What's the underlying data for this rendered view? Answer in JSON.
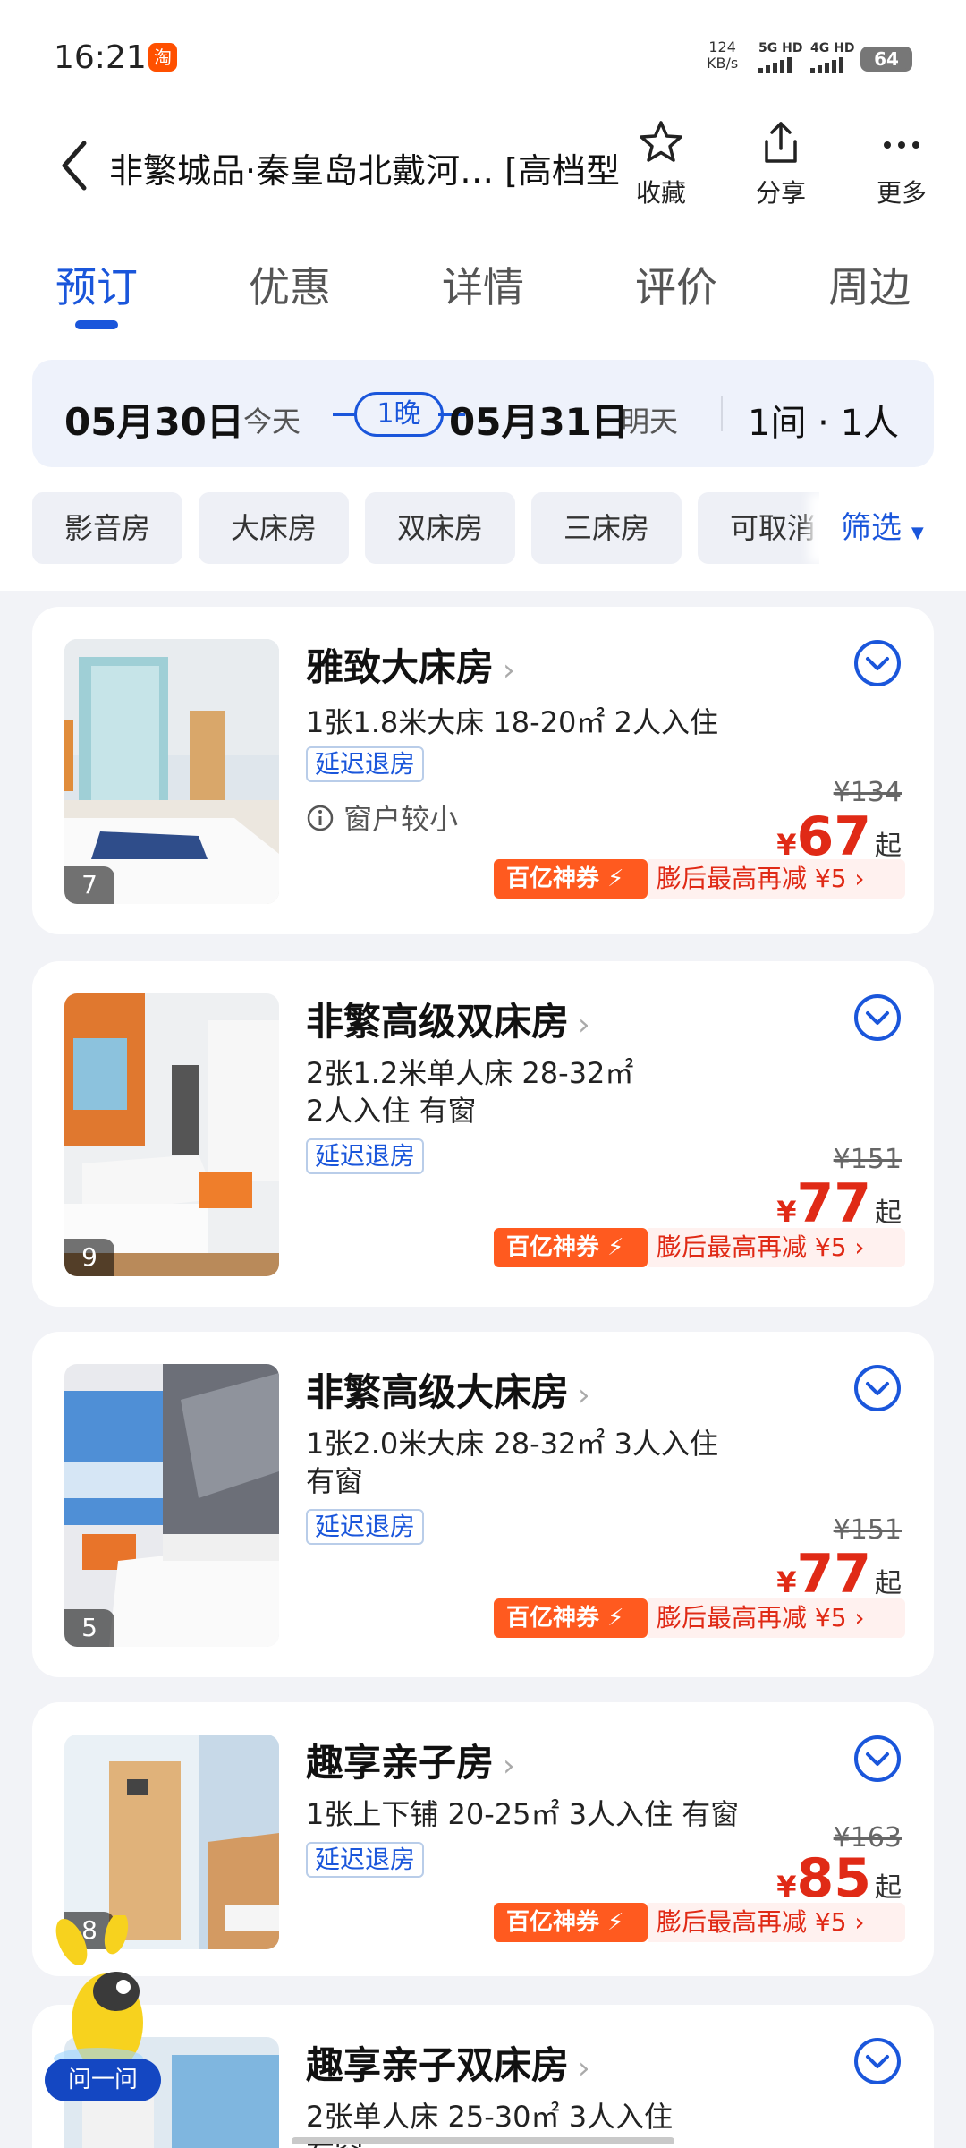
{
  "status_bar": {
    "time": "16:21",
    "app_icon": "淘",
    "net_speed_value": "124",
    "net_speed_unit": "KB/s",
    "sim1": "5G HD",
    "sim2": "4G HD",
    "battery": "64"
  },
  "header": {
    "title": "非繁城品·秦皇岛北戴河… [高档型",
    "favorite_label": "收藏",
    "share_label": "分享",
    "more_label": "更多"
  },
  "tabs": [
    {
      "label": "预订",
      "active": true
    },
    {
      "label": "优惠",
      "active": false
    },
    {
      "label": "详情",
      "active": false
    },
    {
      "label": "评价",
      "active": false
    },
    {
      "label": "周边",
      "active": false
    }
  ],
  "dates": {
    "checkin": "05月30日",
    "checkin_sub": "今天",
    "nights": "1晚",
    "checkout": "05月31日",
    "checkout_sub": "明天",
    "guests": "1间 · 1人"
  },
  "filters": {
    "chips": [
      "影音房",
      "大床房",
      "双床房",
      "三床房",
      "可取消"
    ],
    "filter_label": "筛选"
  },
  "rooms": [
    {
      "name": "雅致大床房",
      "spec_line1": "1张1.8米大床   18-20㎡  2人入住",
      "spec_line2": "",
      "tag": "延迟退房",
      "note": "窗户较小",
      "image_count": "7",
      "old_price": "¥134",
      "currency": "¥",
      "price": "67",
      "price_suffix": "起",
      "promo_badge": "百亿神券",
      "promo_text": "膨后最高再减 ¥5 ›"
    },
    {
      "name": "非繁高级双床房",
      "spec_line1": "2张1.2米单人床   28-32㎡",
      "spec_line2": "2人入住  有窗",
      "tag": "延迟退房",
      "image_count": "9",
      "old_price": "¥151",
      "currency": "¥",
      "price": "77",
      "price_suffix": "起",
      "promo_badge": "百亿神券",
      "promo_text": "膨后最高再减 ¥5 ›"
    },
    {
      "name": "非繁高级大床房",
      "spec_line1": "1张2.0米大床   28-32㎡  3人入住",
      "spec_line2": "有窗",
      "tag": "延迟退房",
      "image_count": "5",
      "old_price": "¥151",
      "currency": "¥",
      "price": "77",
      "price_suffix": "起",
      "promo_badge": "百亿神券",
      "promo_text": "膨后最高再减 ¥5 ›"
    },
    {
      "name": "趣享亲子房",
      "spec_line1": "1张上下铺  20-25㎡  3人入住  有窗",
      "spec_line2": "",
      "tag": "延迟退房",
      "image_count": "8",
      "old_price": "¥163",
      "currency": "¥",
      "price": "85",
      "price_suffix": "起",
      "promo_badge": "百亿神券",
      "promo_text": "膨后最高再减 ¥5 ›"
    },
    {
      "name": "趣享亲子双床房",
      "spec_line1": "2张单人床  25-30㎡  3人入住",
      "spec_line2": "有窗"
    }
  ],
  "assistant": {
    "label": "问一问"
  },
  "colors": {
    "brand_blue": "#1a56db",
    "price_red": "#e02a16",
    "promo_orange": "#ff5a1f"
  }
}
